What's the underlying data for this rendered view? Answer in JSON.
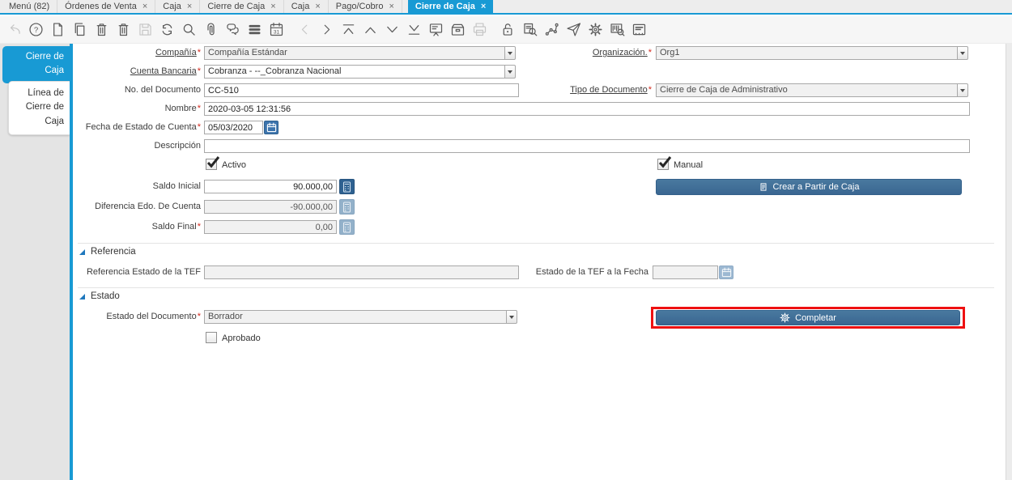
{
  "colors": {
    "accent_blue": "#189ad4",
    "steel_button": "#3e6d99",
    "highlight_red": "#ee1111",
    "disabled_button_blue": "#9cb8d2"
  },
  "tab_close_glyph": "×",
  "required_marker": "*",
  "window_tabs": [
    {
      "label": "Menú (82)",
      "closable": false,
      "active": false
    },
    {
      "label": "Órdenes de Venta",
      "closable": true,
      "active": false
    },
    {
      "label": "Caja",
      "closable": true,
      "active": false
    },
    {
      "label": "Cierre de Caja",
      "closable": true,
      "active": false
    },
    {
      "label": "Caja",
      "closable": true,
      "active": false
    },
    {
      "label": "Pago/Cobro",
      "closable": true,
      "active": false
    },
    {
      "label": "Cierre de Caja",
      "closable": true,
      "active": true
    }
  ],
  "toolbar": {
    "icons": [
      {
        "name": "undo",
        "disabled": true
      },
      {
        "name": "help",
        "disabled": false
      },
      {
        "name": "new-record",
        "disabled": false
      },
      {
        "name": "copy-record",
        "disabled": false
      },
      {
        "name": "delete-record",
        "disabled": false
      },
      {
        "name": "delete-selection",
        "disabled": false
      },
      {
        "name": "save",
        "disabled": true
      },
      {
        "name": "refresh",
        "disabled": false
      },
      {
        "name": "find",
        "disabled": false
      },
      {
        "name": "attachment",
        "disabled": false
      },
      {
        "name": "chat",
        "disabled": false
      },
      {
        "name": "grid-toggle",
        "disabled": false
      },
      {
        "name": "calendar-history",
        "disabled": false
      },
      {
        "name": "parent-record",
        "disabled": true
      },
      {
        "name": "detail-record",
        "disabled": false
      },
      {
        "name": "first-record",
        "disabled": false
      },
      {
        "name": "previous-record",
        "disabled": false
      },
      {
        "name": "next-record",
        "disabled": false
      },
      {
        "name": "last-record",
        "disabled": false
      },
      {
        "name": "report",
        "disabled": false
      },
      {
        "name": "archive",
        "disabled": false
      },
      {
        "name": "print",
        "disabled": true
      },
      {
        "name": "lock",
        "disabled": false
      },
      {
        "name": "zoom-across",
        "disabled": false
      },
      {
        "name": "workflow",
        "disabled": false
      },
      {
        "name": "send-request",
        "disabled": false
      },
      {
        "name": "process",
        "disabled": false
      },
      {
        "name": "product-info",
        "disabled": false
      },
      {
        "name": "window-customization",
        "disabled": false
      }
    ]
  },
  "sidebar": {
    "active_tab": "Cierre de Caja",
    "inactive_tab": "Línea de Cierre de Caja"
  },
  "form": {
    "labels": {
      "compania": "Compañía",
      "organizacion": "Organización.",
      "cuenta_bancaria": "Cuenta Bancaria",
      "no_documento": "No. del Documento",
      "tipo_documento": "Tipo de Documento",
      "nombre": "Nombre",
      "fecha_estado": "Fecha de Estado de Cuenta",
      "descripcion": "Descripción",
      "activo": "Activo",
      "manual": "Manual",
      "saldo_inicial": "Saldo Inicial",
      "diferencia": "Diferencia Edo. De Cuenta",
      "saldo_final": "Saldo Final",
      "referencia_tef": "Referencia Estado de la TEF",
      "estado_tef_fecha": "Estado de la TEF a la Fecha",
      "estado_documento": "Estado del Documento",
      "aprobado": "Aprobado"
    },
    "values": {
      "compania": "Compañía Estándar",
      "organizacion": "Org1",
      "cuenta_bancaria": "Cobranza - --_Cobranza Nacional",
      "no_documento": "CC-510",
      "tipo_documento": "Cierre de Caja de Administrativo",
      "nombre": "2020-03-05 12:31:56",
      "fecha_estado": "05/03/2020",
      "descripcion": "",
      "saldo_inicial": "90.000,00",
      "diferencia": "-90.000,00",
      "saldo_final": "0,00",
      "referencia_tef": "",
      "estado_tef_fecha": "",
      "estado_documento": "Borrador"
    },
    "checkboxes": {
      "activo": true,
      "manual": true,
      "aprobado": false
    },
    "sections": {
      "referencia": "Referencia",
      "estado": "Estado"
    },
    "buttons": {
      "crear": "Crear a Partir de Caja",
      "completar": "Completar"
    }
  }
}
